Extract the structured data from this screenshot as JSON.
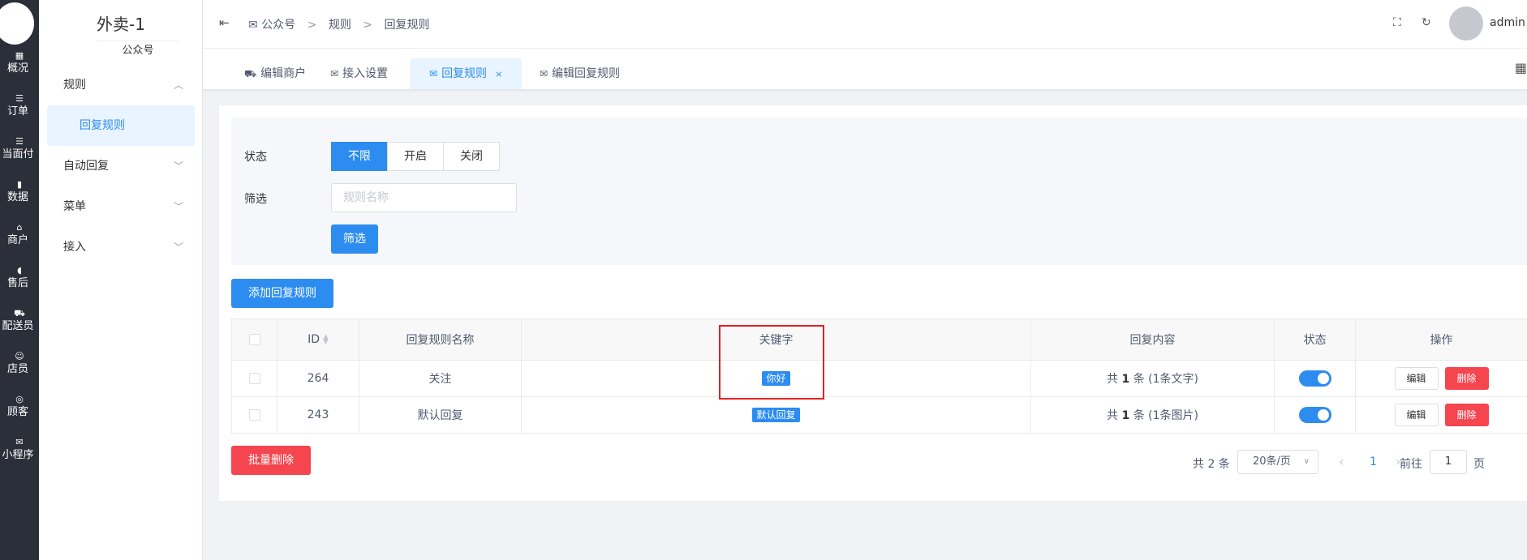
{
  "rail": {
    "items": [
      {
        "icon": "▦",
        "label": "概况"
      },
      {
        "icon": "☰",
        "label": "订单"
      },
      {
        "icon": "☰",
        "label": "当面付"
      },
      {
        "icon": "▮",
        "label": "数据"
      },
      {
        "icon": "⌂",
        "label": "商户"
      },
      {
        "icon": "◖",
        "label": "售后"
      },
      {
        "icon": "⛟",
        "label": "配送员"
      },
      {
        "icon": "☺",
        "label": "店员"
      },
      {
        "icon": "◎",
        "label": "顾客"
      },
      {
        "icon": "✉",
        "label": "小程序"
      }
    ]
  },
  "sidebar": {
    "brand": "外卖-1",
    "brand_sub": "公众号",
    "menu": [
      {
        "label": "规则",
        "chevron": "︿"
      },
      {
        "label": "回复规则"
      },
      {
        "label": "自动回复",
        "chevron": "﹀"
      },
      {
        "label": "菜单",
        "chevron": "﹀"
      },
      {
        "label": "接入",
        "chevron": "﹀"
      }
    ]
  },
  "topbar": {
    "fold_icon": "⇤",
    "crumbs": [
      "公众号",
      "规则",
      "回复规则"
    ],
    "crumb_sep": ">",
    "fullscreen_icon": "⛶",
    "refresh_icon": "↻",
    "user": "admin",
    "user_caret": "∨"
  },
  "tabs": [
    {
      "icon": "⛟",
      "label": "编辑商户"
    },
    {
      "icon": "✉",
      "label": "接入设置"
    },
    {
      "icon": "✉",
      "label": "回复规则",
      "close": "×"
    },
    {
      "icon": "✉",
      "label": "编辑回复规则"
    }
  ],
  "filter": {
    "status_label": "状态",
    "status_options": [
      "不限",
      "开启",
      "关闭"
    ],
    "filter_label": "筛选",
    "search_placeholder": "规则名称",
    "search_button": "筛选"
  },
  "add_button": "添加回复规则",
  "table": {
    "headers": [
      "ID",
      "回复规则名称",
      "关键字",
      "回复内容",
      "状态",
      "操作"
    ],
    "rows": [
      {
        "id": "264",
        "name": "关注",
        "keyword": "你好",
        "content_pre": "共",
        "content_count": "1",
        "content_post": "条 (1条文字)",
        "edit": "编辑",
        "delete": "删除"
      },
      {
        "id": "243",
        "name": "默认回复",
        "keyword": "默认回复",
        "content_pre": "共",
        "content_count": "1",
        "content_post": "条 (1条图片)",
        "edit": "编辑",
        "delete": "删除"
      }
    ]
  },
  "batch_delete": "批量删除",
  "pagination": {
    "total": "共 2 条",
    "page_size": "20条/页",
    "prev": "‹",
    "current": "1",
    "next": "›",
    "goto_label": "前往",
    "goto_value": "1",
    "page_unit": "页"
  },
  "colors": {
    "primary": "#2d8cf0",
    "danger": "#f5454f",
    "highlight": "#e0211f",
    "rail": "#2b2f3a"
  }
}
